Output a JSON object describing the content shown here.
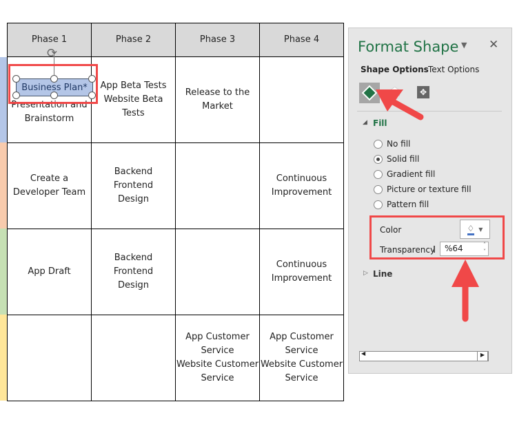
{
  "table": {
    "headers": [
      "Phase 1",
      "Phase 2",
      "Phase 3",
      "Phase 4"
    ],
    "rows": [
      [
        "Presentation and\nBrainstorm",
        "App Beta Tests\nWebsite Beta\nTests",
        "Release to the\nMarket",
        ""
      ],
      [
        "Create a\nDeveloper Team",
        "Backend\nFrontend\nDesign",
        "",
        "Continuous\nImprovement"
      ],
      [
        "App Draft",
        "Backend\nFrontend\nDesign",
        "",
        "Continuous\nImprovement"
      ],
      [
        "",
        "",
        "App Customer\nService\nWebsite Customer\nService",
        "App Customer\nService\nWebsite Customer\nService"
      ]
    ],
    "row_colors": [
      "#b4c6e7",
      "#f8cbad",
      "#c6e0b4",
      "#ffe699"
    ],
    "selected_shape_text": "Business Plan*",
    "shape_fill": "#b4c6e7"
  },
  "panel": {
    "title": "Format Shape",
    "tabs": [
      "Shape Options",
      "Text Options"
    ],
    "icons": [
      "fill-line-icon",
      "effects-icon",
      "size-properties-icon"
    ],
    "fill_label": "Fill",
    "fill_options": [
      "No fill",
      "Solid fill",
      "Gradient fill",
      "Picture or texture fill",
      "Pattern fill"
    ],
    "selected_fill": "Solid fill",
    "color_label": "Color",
    "color_value": "#4472c4",
    "transparency_label": "Transparency",
    "transparency_value": "%64",
    "line_label": "Line",
    "title_color": "#217346",
    "highlight_color": "#f04848"
  }
}
